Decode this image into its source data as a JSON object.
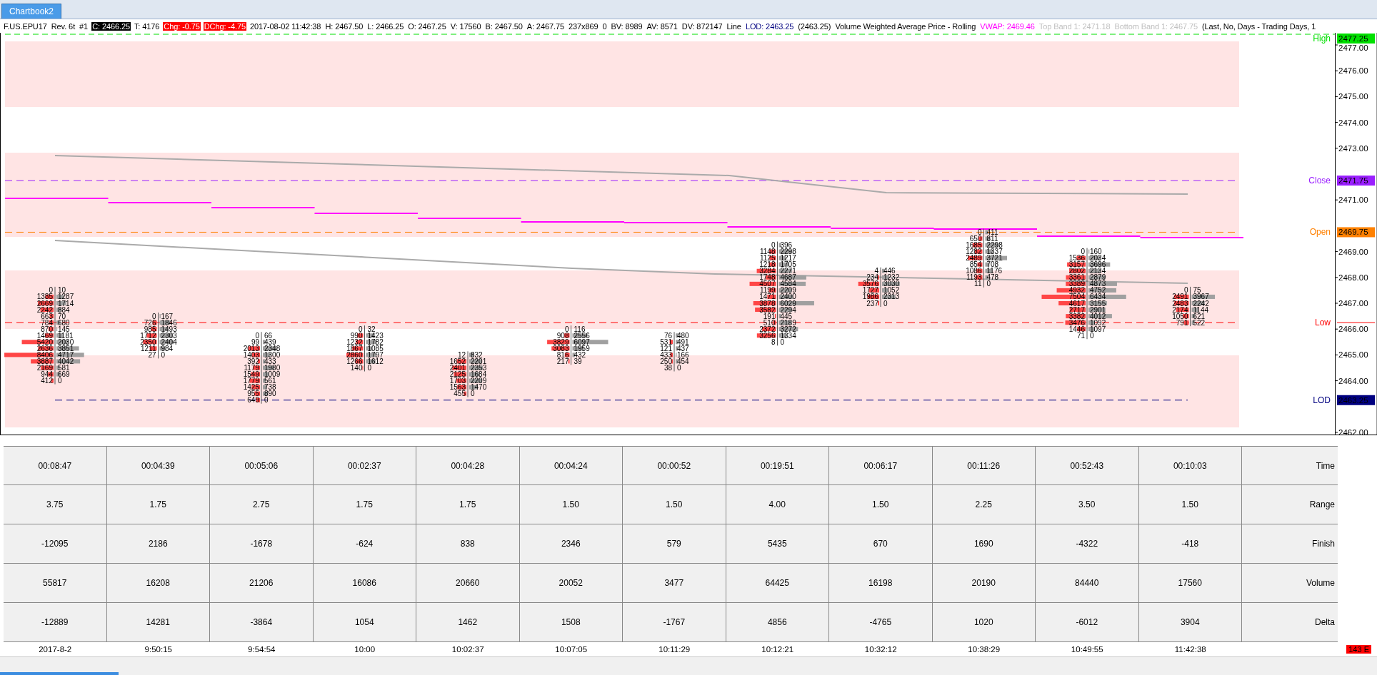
{
  "tab": "Chartbook2",
  "header": [
    {
      "text": "F.US.EPU17",
      "kind": "plain"
    },
    {
      "text": "Rev. 6t",
      "kind": "plain"
    },
    {
      "text": "#1",
      "kind": "plain"
    },
    {
      "text": "C: 2466.25",
      "kind": "inverse"
    },
    {
      "text": "T: 4176",
      "kind": "plain"
    },
    {
      "text": "Chg: -0.75",
      "kind": "alert"
    },
    {
      "text": "DChg: -4.75",
      "kind": "alert"
    },
    {
      "text": "2017-08-02 11:42:38",
      "kind": "plain"
    },
    {
      "text": "H: 2467.50",
      "kind": "plain"
    },
    {
      "text": "L: 2466.25",
      "kind": "plain"
    },
    {
      "text": "O: 2467.25",
      "kind": "plain"
    },
    {
      "text": "V: 17560",
      "kind": "plain"
    },
    {
      "text": "B: 2467.50",
      "kind": "plain"
    },
    {
      "text": "A: 2467.75",
      "kind": "plain"
    },
    {
      "text": "237x869",
      "kind": "plain"
    },
    {
      "text": "0",
      "kind": "plain"
    },
    {
      "text": "BV: 8989",
      "kind": "plain"
    },
    {
      "text": "AV: 8571",
      "kind": "plain"
    },
    {
      "text": "DV: 872147",
      "kind": "plain"
    },
    {
      "text": "Line",
      "kind": "plain"
    },
    {
      "text": "LOD: 2463.25",
      "kind": "lod"
    },
    {
      "text": "(2463.25)",
      "kind": "plain"
    },
    {
      "text": "Volume Weighted Average Price - Rolling",
      "kind": "plain"
    },
    {
      "text": "VWAP: 2469.46",
      "kind": "vwap"
    },
    {
      "text": "Top Band 1: 2471.18",
      "kind": "faint"
    },
    {
      "text": "Bottom Band 1: 2467.75",
      "kind": "faint"
    },
    {
      "text": "(Last, No, Days - Trading Days, 1",
      "kind": "plain"
    }
  ],
  "footprint": [
    {
      "rows": [
        [
          "0",
          "10"
        ],
        [
          "1385",
          "1287"
        ],
        [
          "2669",
          "1714"
        ],
        [
          "2242",
          "884"
        ],
        [
          "663",
          "70"
        ],
        [
          "784",
          "680"
        ],
        [
          "870",
          "145"
        ],
        [
          "1469",
          "1181"
        ],
        [
          "5420",
          "2030"
        ],
        [
          "2636",
          "3851"
        ],
        [
          "8406",
          "4717"
        ],
        [
          "3887",
          "4042"
        ],
        [
          "2169",
          "581"
        ],
        [
          "944",
          "669"
        ],
        [
          "412",
          "0"
        ]
      ]
    },
    {
      "rows": [
        [
          "0",
          "167"
        ],
        [
          "726",
          "1846"
        ],
        [
          "985",
          "1493"
        ],
        [
          "1712",
          "2303"
        ],
        [
          "2350",
          "2404"
        ],
        [
          "1211",
          "984"
        ],
        [
          "27",
          "0"
        ]
      ]
    },
    {
      "rows": [
        [
          "0",
          "66"
        ],
        [
          "99",
          "439"
        ],
        [
          "2013",
          "2348"
        ],
        [
          "1403",
          "1300"
        ],
        [
          "392",
          "433"
        ],
        [
          "1179",
          "1980"
        ],
        [
          "1549",
          "1009"
        ],
        [
          "1779",
          "561"
        ],
        [
          "1425",
          "738"
        ],
        [
          "955",
          "890"
        ],
        [
          "649",
          "0"
        ]
      ]
    },
    {
      "rows": [
        [
          "0",
          "32"
        ],
        [
          "990",
          "1423"
        ],
        [
          "1232",
          "1782"
        ],
        [
          "1867",
          "1085"
        ],
        [
          "2860",
          "1797"
        ],
        [
          "1266",
          "1612"
        ],
        [
          "140",
          "0"
        ]
      ]
    },
    {
      "rows": [
        [
          "12",
          "832"
        ],
        [
          "1652",
          "2201"
        ],
        [
          "2401",
          "2353"
        ],
        [
          "2125",
          "1684"
        ],
        [
          "1703",
          "2209"
        ],
        [
          "1563",
          "1470"
        ],
        [
          "455",
          "0"
        ]
      ]
    },
    {
      "rows": [
        [
          "0",
          "116"
        ],
        [
          "908",
          "2556"
        ],
        [
          "3829",
          "6097"
        ],
        [
          "3083",
          "1959"
        ],
        [
          "816",
          "432"
        ],
        [
          "217",
          "39"
        ]
      ]
    },
    {
      "rows": [
        [
          "76",
          "480"
        ],
        [
          "531",
          "491"
        ],
        [
          "121",
          "437"
        ],
        [
          "433",
          "166"
        ],
        [
          "250",
          "454"
        ],
        [
          "38",
          "0"
        ]
      ]
    },
    {
      "rows": [
        [
          "0",
          "396"
        ],
        [
          "1148",
          "2298"
        ],
        [
          "1125",
          "1217"
        ],
        [
          "1218",
          "1705"
        ],
        [
          "3284",
          "2271"
        ],
        [
          "1748",
          "4687"
        ],
        [
          "4507",
          "4584"
        ],
        [
          "1199",
          "2209"
        ],
        [
          "1471",
          "2400"
        ],
        [
          "3878",
          "6029"
        ],
        [
          "3582",
          "2294"
        ],
        [
          "191",
          "445"
        ],
        [
          "510",
          "2189"
        ],
        [
          "2372",
          "3272"
        ],
        [
          "3256",
          "1334"
        ],
        [
          "8",
          "0"
        ]
      ]
    },
    {
      "rows": [
        [
          "4",
          "446"
        ],
        [
          "234",
          "1232"
        ],
        [
          "3576",
          "3030"
        ],
        [
          "1727",
          "1052"
        ],
        [
          "1986",
          "2313"
        ],
        [
          "237",
          "0"
        ]
      ]
    },
    {
      "rows": [
        [
          "0",
          "411"
        ],
        [
          "650",
          "811"
        ],
        [
          "1685",
          "2298"
        ],
        [
          "1282",
          "1337"
        ],
        [
          "2489",
          "3721"
        ],
        [
          "854",
          "708"
        ],
        [
          "1086",
          "1176"
        ],
        [
          "1193",
          "478"
        ],
        [
          "11",
          "0"
        ]
      ]
    },
    {
      "rows": [
        [
          "0",
          "160"
        ],
        [
          "1536",
          "2034"
        ],
        [
          "3157",
          "3696"
        ],
        [
          "2802",
          "2134"
        ],
        [
          "3361",
          "2879"
        ],
        [
          "3389",
          "4873"
        ],
        [
          "4932",
          "4752"
        ],
        [
          "7504",
          "6434"
        ],
        [
          "4617",
          "3155"
        ],
        [
          "2717",
          "2901"
        ],
        [
          "3382",
          "4012"
        ],
        [
          "3476",
          "1092"
        ],
        [
          "1446",
          "1097"
        ],
        [
          "71",
          "0"
        ]
      ]
    },
    {
      "rows": [
        [
          "0",
          "75"
        ],
        [
          "2491",
          "3967"
        ],
        [
          "2483",
          "2242"
        ],
        [
          "2174",
          "1144"
        ],
        [
          "1050",
          "621"
        ],
        [
          "791",
          "522"
        ]
      ]
    }
  ],
  "markers": [
    {
      "label": "High",
      "value": "2477.25",
      "kind": "high"
    },
    {
      "label": "Close",
      "value": "2471.75",
      "kind": "close"
    },
    {
      "label": "Open",
      "value": "2469.75",
      "kind": "open"
    },
    {
      "label": "Low",
      "kind": "low"
    },
    {
      "label": "LOD",
      "value": "2463.25",
      "kind": "lod"
    }
  ],
  "price_axis": [
    "2477.00",
    "2476.00",
    "2475.00",
    "2474.00",
    "2473.00",
    "2471.00",
    "2469.00",
    "2468.00",
    "2467.00",
    "2466.00",
    "2465.00",
    "2464.00",
    "2462.00"
  ],
  "table": [
    {
      "label": "Time",
      "cells": [
        "00:08:47",
        "00:04:39",
        "00:05:06",
        "00:02:37",
        "00:04:28",
        "00:04:24",
        "00:00:52",
        "00:19:51",
        "00:06:17",
        "00:11:26",
        "00:52:43",
        "00:10:03"
      ]
    },
    {
      "label": "Range",
      "cells": [
        "3.75",
        "1.75",
        "2.75",
        "1.75",
        "1.75",
        "1.50",
        "1.50",
        "4.00",
        "1.50",
        "2.25",
        "3.50",
        "1.50"
      ]
    },
    {
      "label": "Finish",
      "cells": [
        "-12095",
        "2186",
        "-1678",
        "-624",
        "838",
        "2346",
        "579",
        "5435",
        "670",
        "1690",
        "-4322",
        "-418"
      ]
    },
    {
      "label": "Volume",
      "cells": [
        "55817",
        "16208",
        "21206",
        "16086",
        "20660",
        "20052",
        "3477",
        "64425",
        "16198",
        "20190",
        "84440",
        "17560"
      ]
    },
    {
      "label": "Delta",
      "cells": [
        "-12889",
        "14281",
        "-3864",
        "1054",
        "1462",
        "1508",
        "-1767",
        "4856",
        "-4765",
        "1020",
        "-6012",
        "3904"
      ]
    }
  ],
  "time_axis": [
    "2017-8-2",
    "9:50:15",
    "9:54:54",
    "10:00",
    "10:02:37",
    "10:07:05",
    "10:11:29",
    "10:12:21",
    "10:32:12",
    "10:38:29",
    "10:49:55",
    "11:42:38"
  ],
  "status_badge": "143 E"
}
